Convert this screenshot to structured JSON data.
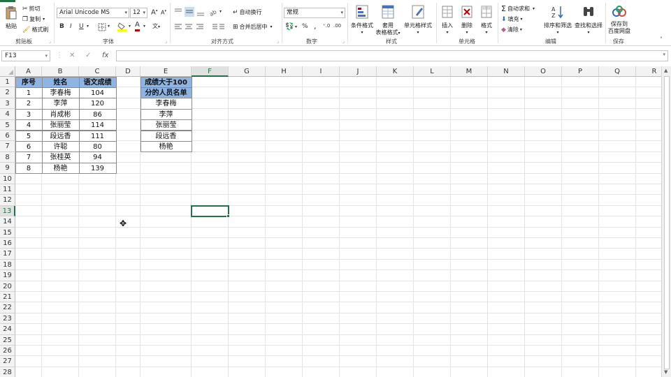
{
  "ribbon": {
    "clipboard": {
      "paste": "粘贴",
      "cut": "剪切",
      "copy": "复制",
      "format_painter": "格式刷",
      "group": "剪贴板"
    },
    "font": {
      "font_name": "Arial Unicode MS",
      "font_size": "12",
      "bold": "B",
      "italic": "I",
      "underline": "U",
      "grow": "A",
      "shrink": "A",
      "group": "字体",
      "wen": "文"
    },
    "alignment": {
      "wrap": "自动换行",
      "merge": "合并后居中",
      "group": "对齐方式"
    },
    "number": {
      "format": "常规",
      "percent": "%",
      "comma": ",",
      "group": "数字"
    },
    "styles": {
      "conditional": "条件格式",
      "table_format_line1": "套用",
      "table_format_line2": "表格格式",
      "cell_styles": "单元格样式",
      "group": "样式"
    },
    "cells": {
      "insert": "插入",
      "delete": "删除",
      "format": "格式",
      "group": "单元格"
    },
    "editing": {
      "autosum": "自动求和",
      "fill": "填充",
      "clear": "清除",
      "sort": "排序和筛选",
      "find": "查找和选择",
      "group": "编辑"
    },
    "save": {
      "label_line1": "保存到",
      "label_line2": "百度网盘",
      "group": "保存"
    }
  },
  "formula_bar": {
    "name_box": "F13",
    "cancel": "✕",
    "enter": "✓",
    "fx": "fx",
    "formula": ""
  },
  "columns": [
    "A",
    "B",
    "C",
    "D",
    "E",
    "F",
    "G",
    "H",
    "I",
    "J",
    "K",
    "L",
    "M",
    "N",
    "O",
    "P",
    "Q",
    "R"
  ],
  "rows": [
    "1",
    "2",
    "3",
    "4",
    "5",
    "6",
    "7",
    "8",
    "9",
    "10",
    "11",
    "12",
    "13",
    "14",
    "15",
    "16",
    "17",
    "18",
    "19",
    "20",
    "21",
    "22",
    "23",
    "24",
    "25",
    "26",
    "27",
    "28"
  ],
  "active_cell": "F13",
  "table1": {
    "headers": [
      "序号",
      "姓名",
      "语文成绩"
    ],
    "rows": [
      [
        "1",
        "李春梅",
        "104"
      ],
      [
        "2",
        "李萍",
        "120"
      ],
      [
        "3",
        "肖成彬",
        "86"
      ],
      [
        "4",
        "张丽莹",
        "114"
      ],
      [
        "5",
        "段远香",
        "111"
      ],
      [
        "6",
        "许聪",
        "80"
      ],
      [
        "7",
        "张桂英",
        "94"
      ],
      [
        "8",
        "杨艳",
        "139"
      ]
    ]
  },
  "table2": {
    "header_line1": "成绩大于100",
    "header_line2": "分的人员名单",
    "names": [
      "李春梅",
      "李萍",
      "张丽莹",
      "段远香",
      "杨艳"
    ]
  },
  "colors": {
    "accent": "#217346",
    "header_fill": "#8db4e2"
  }
}
